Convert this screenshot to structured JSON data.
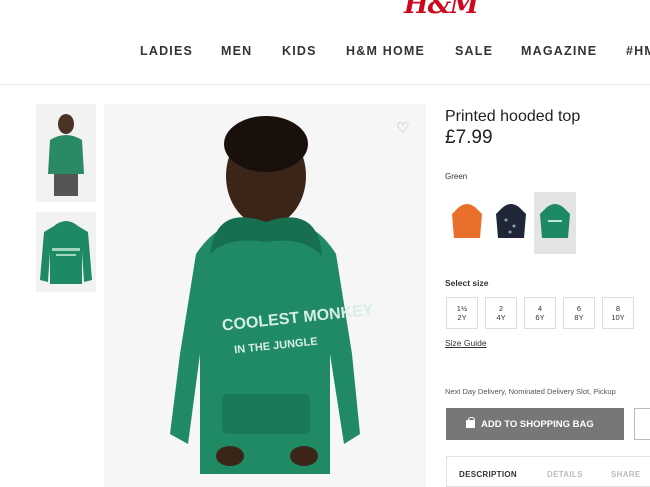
{
  "brand": {
    "logo_text": "H&M",
    "color": "#cc071e"
  },
  "nav": {
    "items": [
      "LADIES",
      "MEN",
      "KIDS",
      "H&M HOME",
      "SALE",
      "MAGAZINE",
      "#HM"
    ]
  },
  "product": {
    "title": "Printed hooded top",
    "price": "£7.99",
    "color_label": "Green",
    "shirt_text_line1": "COOLEST MONKEY",
    "shirt_text_line2": "IN THE JUNGLE",
    "swatches": [
      {
        "name": "orange",
        "color": "#e8702a",
        "selected": false
      },
      {
        "name": "navy",
        "color": "#1e2638",
        "selected": false
      },
      {
        "name": "green",
        "color": "#1d8a63",
        "selected": true
      }
    ],
    "size_label": "Select size",
    "sizes": [
      {
        "top": "1½",
        "bottom": "2Y"
      },
      {
        "top": "2",
        "bottom": "4Y"
      },
      {
        "top": "4",
        "bottom": "6Y"
      },
      {
        "top": "6",
        "bottom": "8Y"
      },
      {
        "top": "8",
        "bottom": "10Y"
      }
    ],
    "size_guide": "Size Guide",
    "delivery_text": "Next Day Delivery, Nominated Delivery Slot, Pickup",
    "add_to_bag": "ADD TO SHOPPING BAG",
    "tabs": [
      "DESCRIPTION",
      "DETAILS",
      "SHARE"
    ]
  },
  "icons": {
    "favourite": "heart-outline-icon",
    "bag": "shopping-bag-icon"
  }
}
